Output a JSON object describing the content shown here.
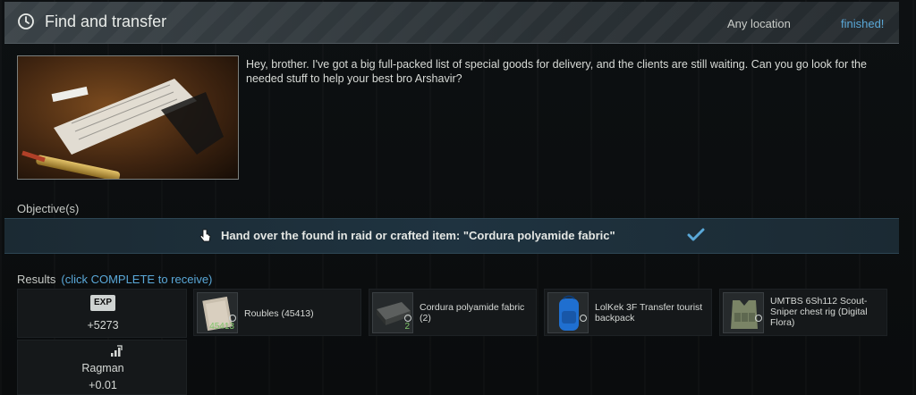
{
  "header": {
    "title": "Find and transfer",
    "location": "Any location",
    "status": "finished!"
  },
  "description": "Hey, brother. I've got a big full-packed list of special goods for delivery, and the clients are still waiting. Can you go look for the needed stuff to help your best bro Arshavir?",
  "objectives": {
    "title": "Objective(s)",
    "items": [
      {
        "text": "Hand over the found in raid or crafted item: \"Cordura polyamide fabric\""
      }
    ]
  },
  "results": {
    "title": "Results",
    "hint": "(click COMPLETE to receive)",
    "exp": {
      "badge": "EXP",
      "value": "+5273"
    },
    "trader": {
      "name": "Ragman",
      "value": "+0.01"
    },
    "items": [
      {
        "name": "Roubles (45413)",
        "count": "45413"
      },
      {
        "name": "Cordura polyamide fabric (2)",
        "count": "2"
      },
      {
        "name": "LolKek 3F Transfer tourist backpack",
        "count": ""
      },
      {
        "name": "UMTBS 6Sh112 Scout-Sniper chest rig (Digital Flora)",
        "count": ""
      }
    ]
  },
  "colors": {
    "accent": "#5aa8d8",
    "count_green": "#7fc66a"
  },
  "icons": [
    "clock-icon",
    "hand-cursor-icon",
    "checkmark-icon",
    "exp-icon",
    "reputation-icon"
  ]
}
